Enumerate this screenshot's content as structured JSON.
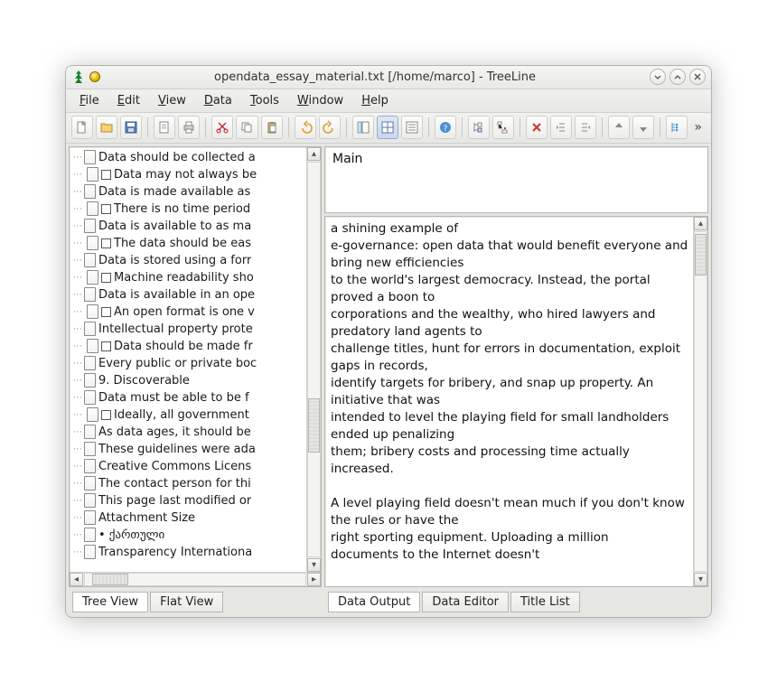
{
  "window": {
    "title": "opendata_essay_material.txt [/home/marco] - TreeLine",
    "minimize_tip": "Minimize",
    "maximize_tip": "Maximize",
    "close_tip": "Close"
  },
  "menu": {
    "file": "File",
    "edit": "Edit",
    "view": "View",
    "data": "Data",
    "tools": "Tools",
    "window": "Window",
    "help": "Help"
  },
  "left_tabs": {
    "tree": "Tree View",
    "flat": "Flat View"
  },
  "right_tabs": {
    "output": "Data Output",
    "editor": "Data Editor",
    "titles": "Title List"
  },
  "tree_items": [
    {
      "lvl": 0,
      "check": false,
      "text": "Data should be collected a"
    },
    {
      "lvl": 1,
      "check": true,
      "text": "Data may not always be"
    },
    {
      "lvl": 0,
      "check": false,
      "text": "Data is made available as"
    },
    {
      "lvl": 1,
      "check": true,
      "text": "There is no time period"
    },
    {
      "lvl": 0,
      "check": false,
      "text": "Data is available to as ma"
    },
    {
      "lvl": 1,
      "check": true,
      "text": "The data should be eas"
    },
    {
      "lvl": 0,
      "check": false,
      "text": "Data is stored using a forr"
    },
    {
      "lvl": 1,
      "check": true,
      "text": "Machine readability sho"
    },
    {
      "lvl": 0,
      "check": false,
      "text": "Data is available in an ope"
    },
    {
      "lvl": 1,
      "check": true,
      "text": "An open format is one v"
    },
    {
      "lvl": 0,
      "check": false,
      "text": "Intellectual property prote"
    },
    {
      "lvl": 1,
      "check": true,
      "text": "Data should be made fr"
    },
    {
      "lvl": 0,
      "check": false,
      "text": "Every public or private boc"
    },
    {
      "lvl": 0,
      "check": false,
      "text": "9. Discoverable"
    },
    {
      "lvl": 0,
      "check": false,
      "text": "Data must be able to be f"
    },
    {
      "lvl": 1,
      "check": true,
      "text": "Ideally, all government"
    },
    {
      "lvl": 0,
      "check": false,
      "text": "As data ages, it should be"
    },
    {
      "lvl": 0,
      "check": false,
      "text": "These guidelines were ada"
    },
    {
      "lvl": 0,
      "check": false,
      "text": "Creative Commons Licens"
    },
    {
      "lvl": 0,
      "check": false,
      "text": "The contact person for thi"
    },
    {
      "lvl": 0,
      "check": false,
      "text": "This page last modified or"
    },
    {
      "lvl": 0,
      "check": false,
      "text": "Attachment            Size"
    },
    {
      "lvl": 0,
      "check": false,
      "text": "• ქართული"
    },
    {
      "lvl": 0,
      "check": false,
      "text": "Transparency Internationa"
    }
  ],
  "header_title": "Main",
  "content_text": "a shining example of\ne-governance: open data that would benefit everyone and bring new efficiencies\nto the world's largest democracy. Instead, the portal proved a boon to\ncorporations and the wealthy, who hired lawyers and predatory land agents to\nchallenge titles, hunt for errors in documentation, exploit gaps in records,\nidentify targets for bribery, and snap up property. An initiative that was\nintended to level the playing field for small landholders ended up penalizing\nthem; bribery costs and processing time actually increased.\n\nA level playing field doesn't mean much if you don't know the rules or have the\nright sporting equipment. Uploading a million\ndocuments to the Internet doesn't"
}
